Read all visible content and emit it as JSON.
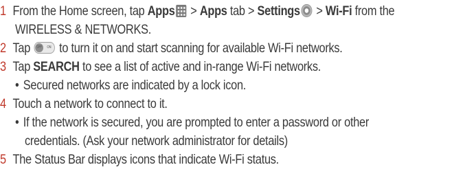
{
  "steps": [
    {
      "num": "1",
      "part1": "From the Home screen, tap ",
      "apps": "Apps",
      "sep1": " > ",
      "apps_tab": "Apps",
      "tab_word": " tab > ",
      "settings": "Settings",
      "sep2": " > ",
      "wifi": "Wi-Fi",
      "part2": " from the",
      "cont": "WIRELESS & NETWORKS.",
      "icons": [
        "apps-grid-icon",
        "settings-gear-icon"
      ]
    },
    {
      "num": "2",
      "part1": "Tap ",
      "part2": " to turn it on and start scanning for available Wi-Fi networks.",
      "icons": [
        "off-on-toggle-icon"
      ],
      "toggle_off": "OFF",
      "toggle_on": "ON"
    },
    {
      "num": "3",
      "part1": "Tap ",
      "bold": "SEARCH",
      "part2": " to see a list of active and in-range Wi-Fi networks.",
      "bullets": [
        "Secured networks are indicated by a lock icon."
      ]
    },
    {
      "num": "4",
      "text": "Touch a network to connect to it.",
      "bullet_line1": "If the network is secured, you are prompted to enter a password or other",
      "bullet_line2": "credentials. (Ask your network administrator for details)"
    },
    {
      "num": "5",
      "text": "The Status Bar displays icons that indicate Wi-Fi status."
    }
  ],
  "bullet_char": "•",
  "colors": {
    "number": "#c0392b",
    "text": "#3a3a3a"
  }
}
